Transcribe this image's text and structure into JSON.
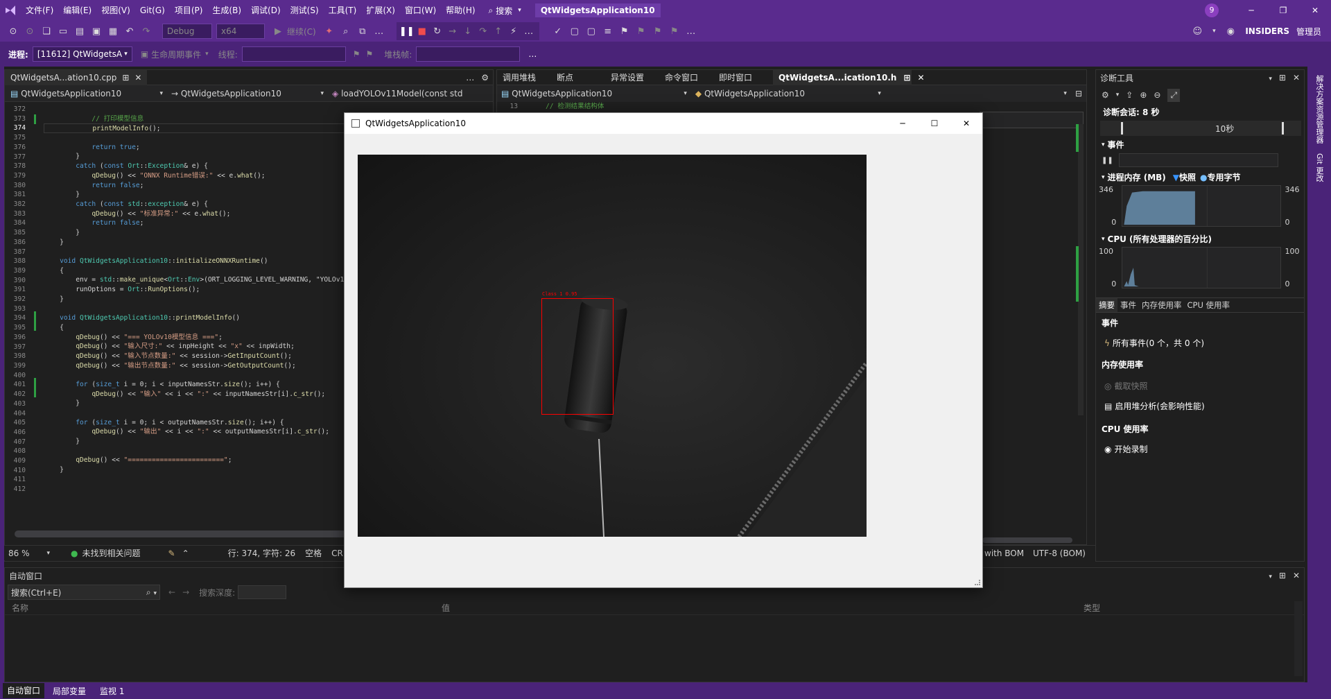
{
  "titlebar": {
    "menus": [
      "文件(F)",
      "编辑(E)",
      "视图(V)",
      "Git(G)",
      "项目(P)",
      "生成(B)",
      "调试(D)",
      "测试(S)",
      "工具(T)",
      "扩展(X)",
      "窗口(W)",
      "帮助(H)"
    ],
    "search_label": "搜索",
    "app_title": "QtWidgetsApplication10",
    "notification_count": "9"
  },
  "toolbar": {
    "config": "Debug",
    "platform": "x64",
    "continue_label": "继续(C)",
    "insiders": "INSIDERS",
    "admin": "管理员"
  },
  "debugbar": {
    "process_label": "进程:",
    "process_value": "[11612] QtWidgetsA",
    "lifecycle_label": "生命周期事件",
    "thread_label": "线程:",
    "stack_label": "堆栈帧:"
  },
  "left_editor": {
    "tab_title": "QtWidgetsA...ation10.cpp",
    "nav_project": "QtWidgetsApplication10",
    "nav_scope": "QtWidgetsApplication10",
    "nav_member": "loadYOLOv11Model(const std"
  },
  "right_editor": {
    "tabs": [
      "调用堆栈",
      "断点",
      "异常设置",
      "命令窗口",
      "即时窗口",
      "QtWidgetsA...ication10.h"
    ],
    "nav_project": "QtWidgetsApplication10",
    "nav_scope": "QtWidgetsApplication10",
    "line_no": "13",
    "comment": "// 检测结果结构体"
  },
  "code_lines": [
    {
      "n": "372",
      "t": ""
    },
    {
      "n": "373",
      "t": "            // 打印模型信息"
    },
    {
      "n": "374",
      "t": "            printModelInfo();"
    },
    {
      "n": "375",
      "t": ""
    },
    {
      "n": "376",
      "t": "            return true;"
    },
    {
      "n": "377",
      "t": "        }"
    },
    {
      "n": "378",
      "t": "        catch (const Ort::Exception& e) {"
    },
    {
      "n": "379",
      "t": "            qDebug() << \"ONNX Runtime错误:\" << e.what();"
    },
    {
      "n": "380",
      "t": "            return false;"
    },
    {
      "n": "381",
      "t": "        }"
    },
    {
      "n": "382",
      "t": "        catch (const std::exception& e) {"
    },
    {
      "n": "383",
      "t": "            qDebug() << \"标准异常:\" << e.what();"
    },
    {
      "n": "384",
      "t": "            return false;"
    },
    {
      "n": "385",
      "t": "        }"
    },
    {
      "n": "386",
      "t": "    }"
    },
    {
      "n": "387",
      "t": ""
    },
    {
      "n": "388",
      "t": "    void QtWidgetsApplication10::initializeONNXRuntime()"
    },
    {
      "n": "389",
      "t": "    {"
    },
    {
      "n": "390",
      "t": "        env = std::make_unique<Ort::Env>(ORT_LOGGING_LEVEL_WARNING, \"YOLOv11"
    },
    {
      "n": "391",
      "t": "        runOptions = Ort::RunOptions();"
    },
    {
      "n": "392",
      "t": "    }"
    },
    {
      "n": "393",
      "t": ""
    },
    {
      "n": "394",
      "t": "    void QtWidgetsApplication10::printModelInfo()"
    },
    {
      "n": "395",
      "t": "    {"
    },
    {
      "n": "396",
      "t": "        qDebug() << \"=== YOLOv10模型信息 ===\";"
    },
    {
      "n": "397",
      "t": "        qDebug() << \"输入尺寸:\" << inpHeight << \"x\" << inpWidth;"
    },
    {
      "n": "398",
      "t": "        qDebug() << \"输入节点数量:\" << session->GetInputCount();"
    },
    {
      "n": "399",
      "t": "        qDebug() << \"输出节点数量:\" << session->GetOutputCount();"
    },
    {
      "n": "400",
      "t": ""
    },
    {
      "n": "401",
      "t": "        for (size_t i = 0; i < inputNamesStr.size(); i++) {"
    },
    {
      "n": "402",
      "t": "            qDebug() << \"输入\" << i << \":\" << inputNamesStr[i].c_str();"
    },
    {
      "n": "403",
      "t": "        }"
    },
    {
      "n": "404",
      "t": ""
    },
    {
      "n": "405",
      "t": "        for (size_t i = 0; i < outputNamesStr.size(); i++) {"
    },
    {
      "n": "406",
      "t": "            qDebug() << \"输出\" << i << \":\" << outputNamesStr[i].c_str();"
    },
    {
      "n": "407",
      "t": "        }"
    },
    {
      "n": "408",
      "t": ""
    },
    {
      "n": "409",
      "t": "        qDebug() << \"========================\";"
    },
    {
      "n": "410",
      "t": "    }"
    },
    {
      "n": "411",
      "t": ""
    },
    {
      "n": "412",
      "t": ""
    }
  ],
  "statusbar": {
    "zoom": "86 %",
    "issues": "未找到相关问题",
    "position": "行: 374, 字符: 26",
    "spaces": "空格",
    "crlf": "CR",
    "encoding_left": "with BOM",
    "encoding": "UTF-8 (BOM)"
  },
  "diag": {
    "title": "诊断工具",
    "session": "诊断会话: 8 秒",
    "timeline_label": "10秒",
    "events_header": "事件",
    "memory_header": "进程内存 (MB)",
    "snapshot_legend": "快照",
    "private_legend": "专用字节",
    "mem_max": "346",
    "mem_min": "0",
    "cpu_header": "CPU (所有处理器的百分比)",
    "cpu_max": "100",
    "cpu_min": "0",
    "tabs": [
      "摘要",
      "事件",
      "内存使用率",
      "CPU 使用率"
    ],
    "events_section": "事件",
    "all_events": "所有事件(0 个，共 0 个)",
    "memory_section": "内存使用率",
    "take_snapshot": "截取快照",
    "heap_profiling": "启用堆分析(会影响性能)",
    "cpu_section": "CPU 使用率",
    "start_record": "开始录制"
  },
  "side_tabs": [
    "解决方案资源管理器",
    "Git 更改"
  ],
  "autos": {
    "title": "自动窗口",
    "search_placeholder": "搜索(Ctrl+E)",
    "depth_label": "搜索深度:",
    "col_name": "名称",
    "col_value": "值",
    "col_type": "类型",
    "bottom_tabs": [
      "自动窗口",
      "局部变量",
      "监视 1"
    ]
  },
  "qtwindow": {
    "title": "QtWidgetsApplication10",
    "detection_label": "Class 1 0.95"
  },
  "colors": {
    "accent": "#5a2b8e",
    "detection": "#ff0000",
    "chart_fill": "#5e7f9a"
  }
}
